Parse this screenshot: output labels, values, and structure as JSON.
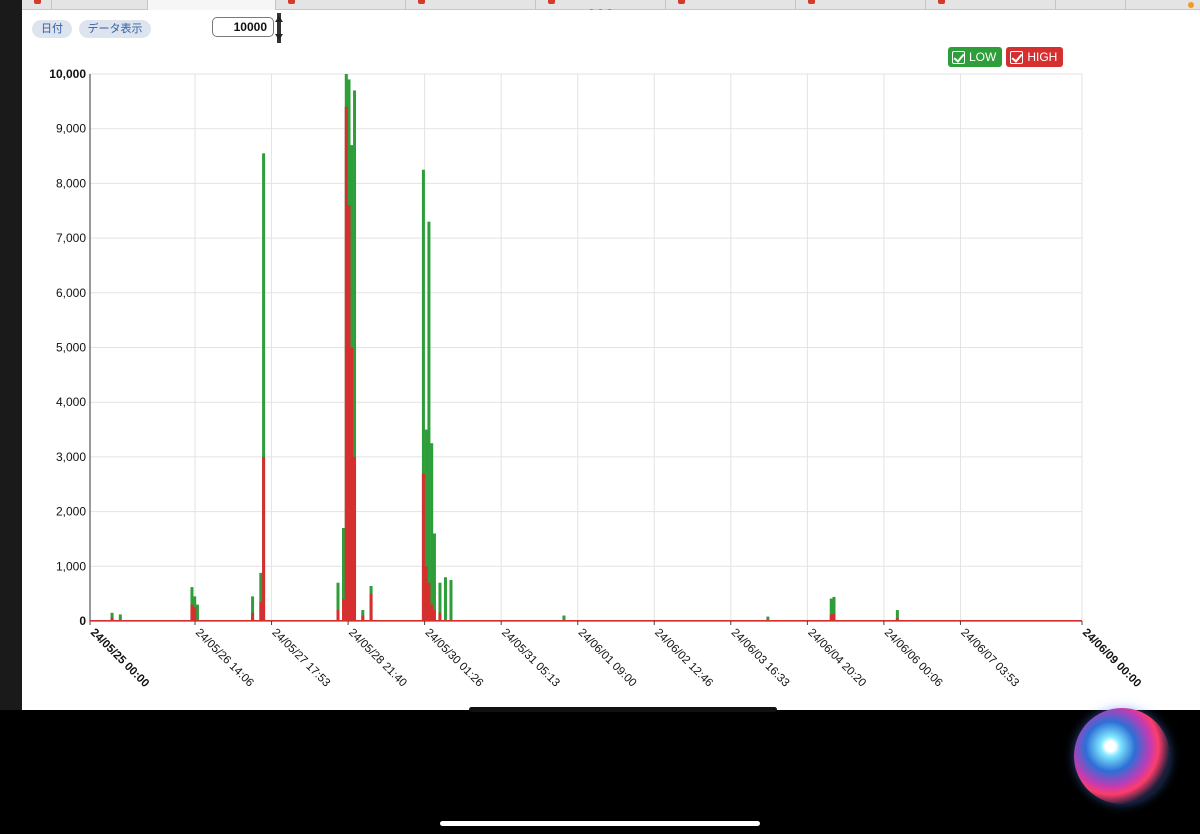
{
  "toolbar": {
    "date_button": "日付",
    "data_button": "データ表示",
    "max_value": "10000"
  },
  "legend": [
    {
      "label": "LOW",
      "color": "#2e9e3a"
    },
    {
      "label": "HIGH",
      "color": "#d62f2f"
    }
  ],
  "chart_data": {
    "type": "area",
    "ylim": [
      0,
      10000
    ],
    "yticks": [
      "0",
      "1,000",
      "2,000",
      "3,000",
      "4,000",
      "5,000",
      "6,000",
      "7,000",
      "8,000",
      "9,000",
      "10,000"
    ],
    "xlim": [
      "24/05/25 00:00",
      "24/06/09 00:00"
    ],
    "xticks": [
      "24/05/25 00:00",
      "24/05/26 14:06",
      "24/05/27 17:53",
      "24/05/28 21:40",
      "24/05/30 01:26",
      "24/05/31 05:13",
      "24/06/01 09:00",
      "24/06/02 12:46",
      "24/06/03 16:33",
      "24/06/04 20:20",
      "24/06/06 00:06",
      "24/06/07 03:53",
      "24/06/09 00:00"
    ],
    "grid": true,
    "legend_position": "top-right",
    "series": [
      {
        "name": "LOW",
        "color": "#2e9e3a",
        "points": [
          [
            "24/05/25 08:00",
            150
          ],
          [
            "24/05/25 11:00",
            120
          ],
          [
            "24/05/26 13:00",
            620
          ],
          [
            "24/05/26 14:00",
            450
          ],
          [
            "24/05/26 15:00",
            300
          ],
          [
            "24/05/27 11:00",
            450
          ],
          [
            "24/05/27 14:00",
            880
          ],
          [
            "24/05/27 15:00",
            8550
          ],
          [
            "24/05/28 18:00",
            700
          ],
          [
            "24/05/28 20:00",
            1700
          ],
          [
            "24/05/28 21:00",
            10000
          ],
          [
            "24/05/28 22:00",
            9900
          ],
          [
            "24/05/28 23:00",
            8700
          ],
          [
            "24/05/29 00:00",
            9700
          ],
          [
            "24/05/29 03:00",
            200
          ],
          [
            "24/05/29 06:00",
            640
          ],
          [
            "24/05/30 01:00",
            8250
          ],
          [
            "24/05/30 02:00",
            3500
          ],
          [
            "24/05/30 03:00",
            7300
          ],
          [
            "24/05/30 04:00",
            3250
          ],
          [
            "24/05/30 05:00",
            1600
          ],
          [
            "24/05/30 07:00",
            700
          ],
          [
            "24/05/30 09:00",
            800
          ],
          [
            "24/05/30 11:00",
            750
          ],
          [
            "24/06/01 04:00",
            100
          ],
          [
            "24/06/04 06:00",
            80
          ],
          [
            "24/06/05 05:00",
            410
          ],
          [
            "24/06/05 06:00",
            440
          ],
          [
            "24/06/06 05:00",
            200
          ]
        ]
      },
      {
        "name": "HIGH",
        "color": "#d62f2f",
        "points": [
          [
            "24/05/25 08:00",
            60
          ],
          [
            "24/05/26 13:00",
            300
          ],
          [
            "24/05/26 14:00",
            250
          ],
          [
            "24/05/27 11:00",
            150
          ],
          [
            "24/05/27 14:00",
            350
          ],
          [
            "24/05/27 15:00",
            3000
          ],
          [
            "24/05/28 18:00",
            200
          ],
          [
            "24/05/28 20:00",
            400
          ],
          [
            "24/05/28 21:00",
            9400
          ],
          [
            "24/05/28 22:00",
            7600
          ],
          [
            "24/05/28 23:00",
            5000
          ],
          [
            "24/05/29 00:00",
            3000
          ],
          [
            "24/05/29 03:00",
            100
          ],
          [
            "24/05/29 06:00",
            500
          ],
          [
            "24/05/30 01:00",
            2700
          ],
          [
            "24/05/30 02:00",
            1000
          ],
          [
            "24/05/30 03:00",
            700
          ],
          [
            "24/05/30 04:00",
            300
          ],
          [
            "24/05/30 05:00",
            200
          ],
          [
            "24/05/30 07:00",
            150
          ],
          [
            "24/06/05 05:00",
            120
          ],
          [
            "24/06/05 06:00",
            130
          ],
          [
            "24/06/06 05:00",
            50
          ]
        ]
      }
    ]
  }
}
